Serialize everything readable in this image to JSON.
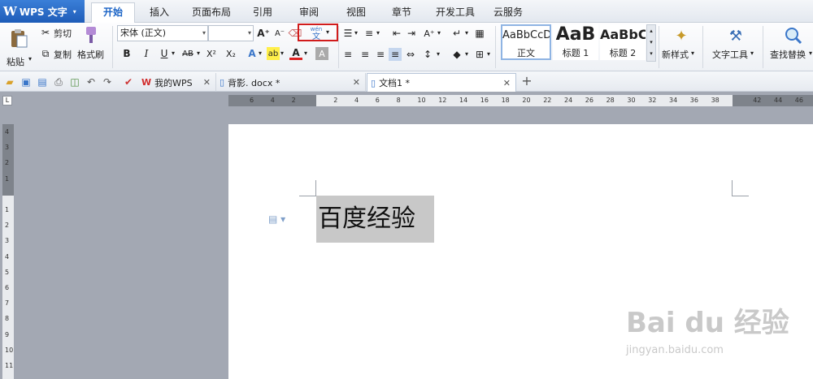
{
  "app": {
    "logo": "W",
    "title": "WPS 文字",
    "caret": "▾"
  },
  "menu": {
    "tabs": [
      {
        "label": "开始"
      },
      {
        "label": "插入"
      },
      {
        "label": "页面布局"
      },
      {
        "label": "引用"
      },
      {
        "label": "审阅"
      },
      {
        "label": "视图"
      },
      {
        "label": "章节"
      },
      {
        "label": "开发工具"
      },
      {
        "label": "云服务"
      }
    ],
    "active_tab": "开始"
  },
  "ribbon": {
    "paste": "粘贴",
    "cut": "剪切",
    "copy": "复制",
    "format_painter": "格式刷",
    "font_name": "宋体 (正文)",
    "font_size": "",
    "grow_font": "A⁺",
    "shrink_font": "A⁻",
    "bold": "B",
    "italic": "I",
    "underline": "U",
    "strikethrough": "AB",
    "superscript": "X²",
    "subscript": "X₂",
    "text_effect": "A",
    "highlight": "ab",
    "font_color": "A",
    "char_shading": "A",
    "phonetic_top": "wén",
    "phonetic_bottom": "文",
    "styles": [
      {
        "sample": "AaBbCcDd",
        "name": "正文"
      },
      {
        "sample": "AaB",
        "name": "标题 1"
      },
      {
        "sample": "AaBbC",
        "name": "标题 2"
      }
    ],
    "new_style": "新样式",
    "text_tools": "文字工具",
    "find_replace": "查找替换"
  },
  "doc_tabs": [
    {
      "label": "我的WPS"
    },
    {
      "label": "背影. docx *"
    },
    {
      "label": "文档1 *"
    }
  ],
  "doc_tab_close": "✕",
  "new_tab": "+",
  "ruler": {
    "corner": "L",
    "h_ticks": [
      "6",
      "4",
      "2",
      "",
      "2",
      "4",
      "6",
      "8",
      "10",
      "12",
      "14",
      "16",
      "18",
      "20",
      "22",
      "24",
      "26",
      "28",
      "30",
      "32",
      "34",
      "36",
      "38",
      "",
      "42",
      "44",
      "46"
    ],
    "v_ticks": [
      "4",
      "3",
      "2",
      "1",
      "",
      "1",
      "2",
      "3",
      "4",
      "5",
      "6",
      "7",
      "8",
      "9",
      "10",
      "11"
    ]
  },
  "document": {
    "text": "百度经验"
  },
  "watermark": {
    "brand": "Bai du 经验",
    "url": "jingyan.baidu.com"
  },
  "colors": {
    "accent": "#1a63c6",
    "highlight_box": "#d11c1c",
    "selection": "#c8c8c8"
  }
}
